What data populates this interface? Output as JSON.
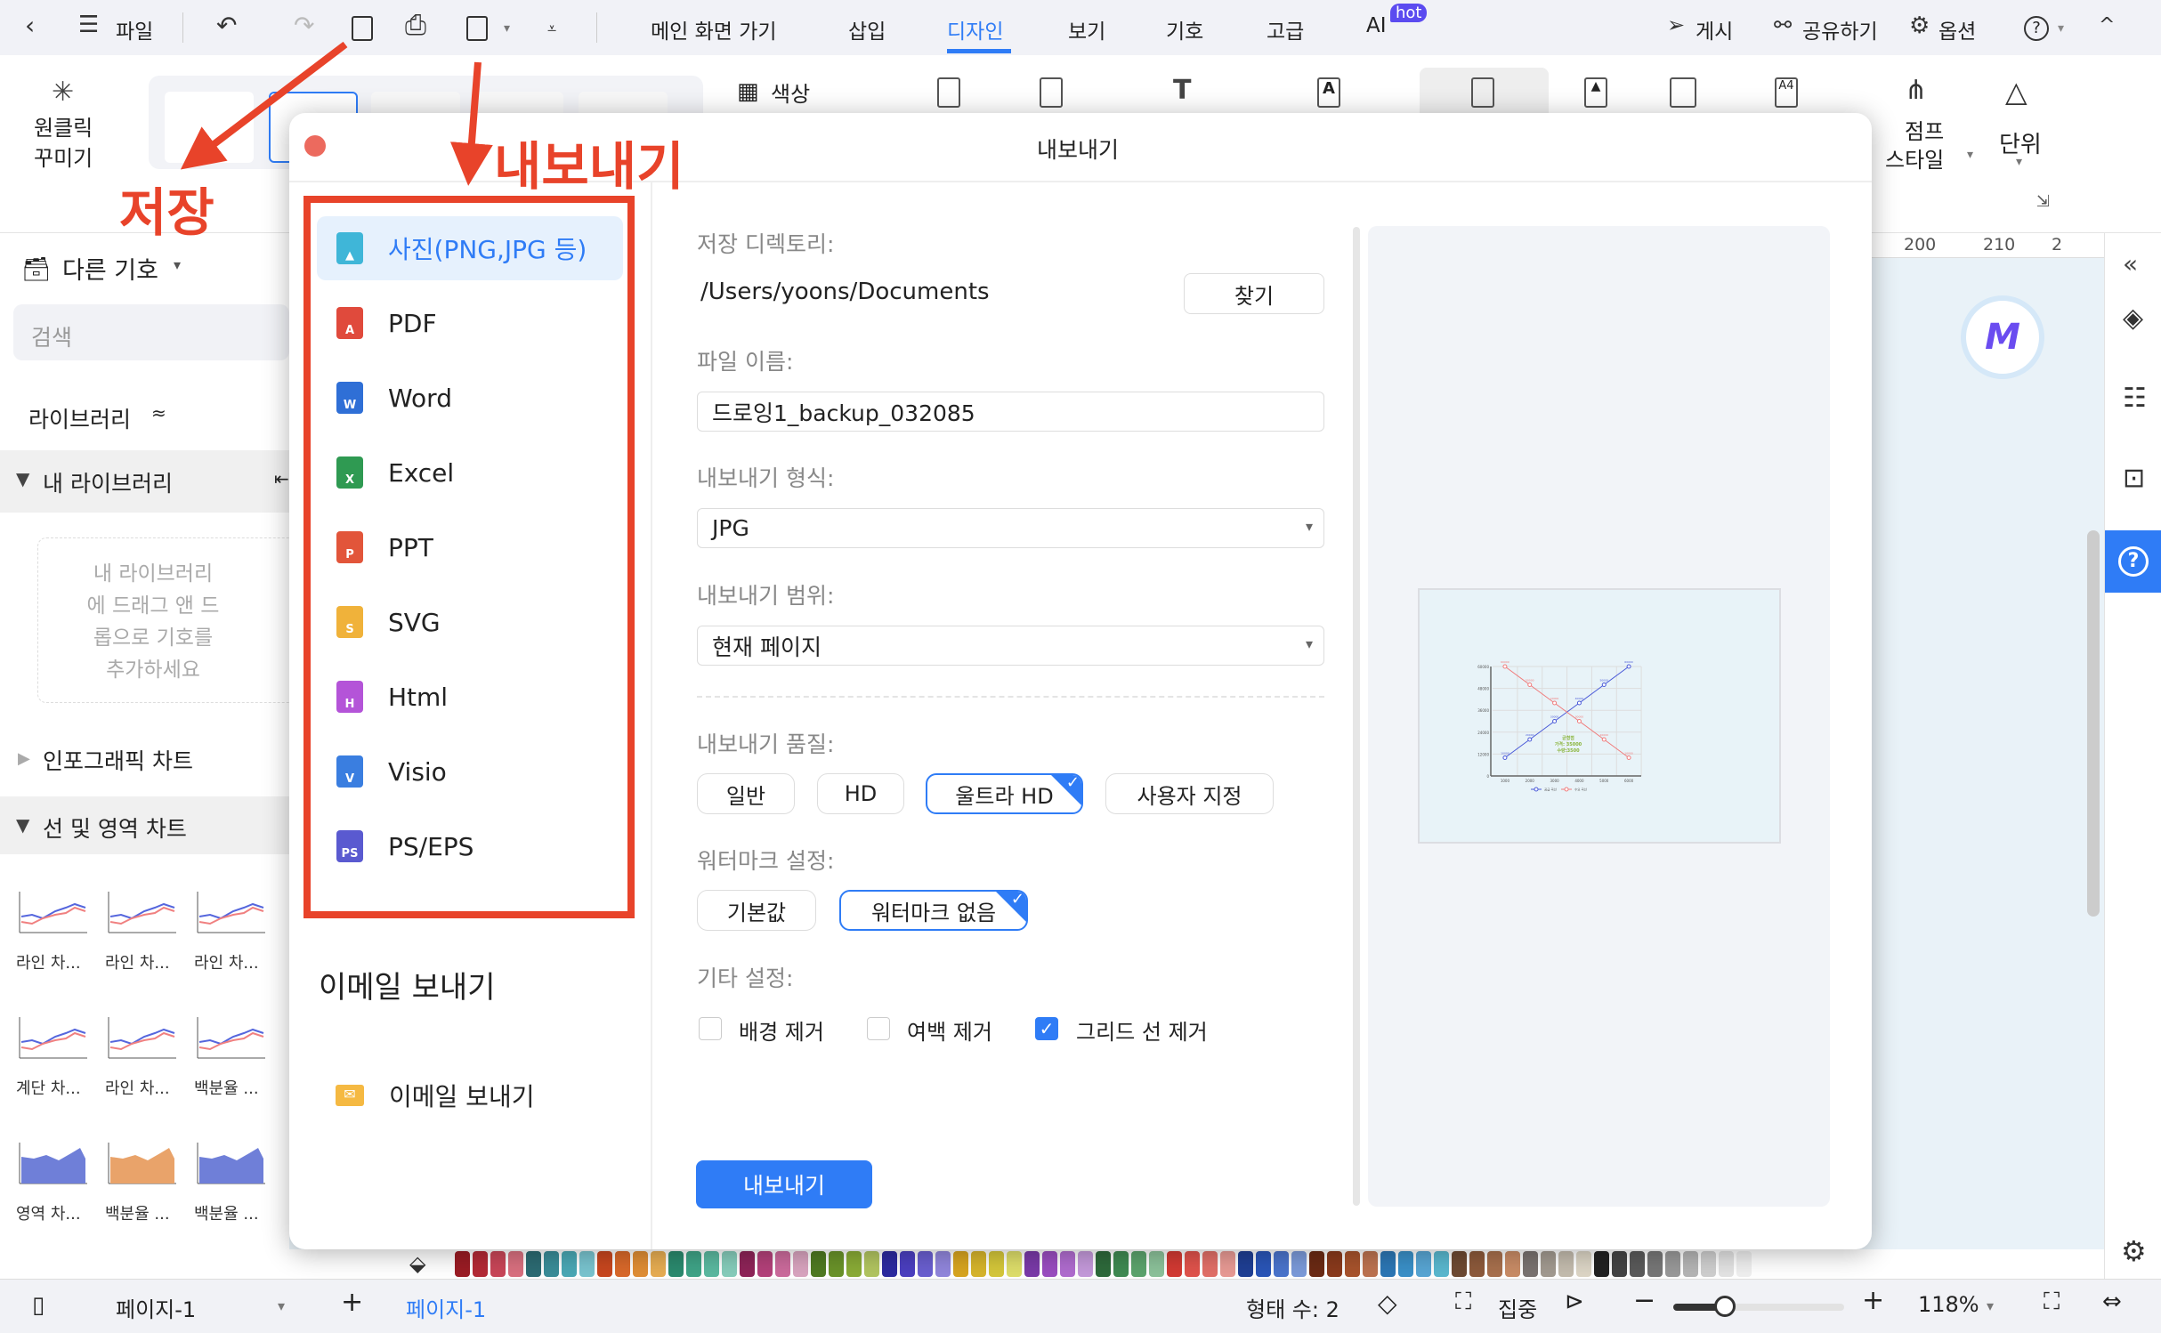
{
  "menubar": {
    "file_label": "파일",
    "tabs": [
      {
        "label": "메인 화면 가기"
      },
      {
        "label": "삽입"
      },
      {
        "label": "디자인",
        "active": true
      },
      {
        "label": "보기"
      },
      {
        "label": "기호"
      },
      {
        "label": "고급"
      },
      {
        "label": "AI",
        "badge": "hot"
      }
    ],
    "publish_label": "게시",
    "share_label": "공유하기",
    "options_label": "옵션",
    "accent_color": "#2f7cf6"
  },
  "ribbon": {
    "one_click_label_1": "원클릭",
    "one_click_label_2": "꾸미기",
    "color_label": "색상",
    "jump_style_label_1": "점프",
    "jump_style_label_2": "스타일",
    "unit_label": "단위"
  },
  "annotations": {
    "save_text": "저장",
    "export_text": "내보내기",
    "color": "#e8432a"
  },
  "sidebar": {
    "title": "다른 기호",
    "search_placeholder": "검색",
    "library_label": "라이브러리",
    "my_library_label": "내 라이브러리",
    "drop_hint": [
      "내 라이브러리",
      "에 드래그 앤 드",
      "롭으로 기호를",
      "추가하세요"
    ],
    "infographic_label": "인포그래픽 차트",
    "line_area_label": "선 및 영역 차트",
    "thumbnails": [
      {
        "label": "라인 차..."
      },
      {
        "label": "라인 차..."
      },
      {
        "label": "라인 차..."
      },
      {
        "label": "계단 차..."
      },
      {
        "label": "라인 차..."
      },
      {
        "label": "백분율 ..."
      },
      {
        "label": "영역 차..."
      },
      {
        "label": "백분율 ..."
      },
      {
        "label": "백분율 ..."
      }
    ]
  },
  "dialog": {
    "title": "내보내기",
    "formats": [
      {
        "label": "사진(PNG,JPG 등)",
        "color": "#3fb6d8",
        "glyph": "▲",
        "selected": true
      },
      {
        "label": "PDF",
        "color": "#e04a3c",
        "glyph": "A"
      },
      {
        "label": "Word",
        "color": "#2f6fd6",
        "glyph": "W"
      },
      {
        "label": "Excel",
        "color": "#2f9a52",
        "glyph": "X"
      },
      {
        "label": "PPT",
        "color": "#e2553a",
        "glyph": "P"
      },
      {
        "label": "SVG",
        "color": "#f0b23a",
        "glyph": "S"
      },
      {
        "label": "Html",
        "color": "#b454d8",
        "glyph": "H"
      },
      {
        "label": "Visio",
        "color": "#3a7ee0",
        "glyph": "V"
      },
      {
        "label": "PS/EPS",
        "color": "#5a5ad0",
        "glyph": "PS"
      }
    ],
    "email_heading": "이메일 보내기",
    "email_item": "이메일 보내기",
    "dir_label": "저장 디렉토리:",
    "dir_value": "/Users/yoons/Documents",
    "browse_label": "찾기",
    "filename_label": "파일 이름:",
    "filename_value": "드로잉1_backup_032085",
    "format_label": "내보내기 형식:",
    "format_value": "JPG",
    "range_label": "내보내기 범위:",
    "range_value": "현재 페이지",
    "quality_label": "내보내기 품질:",
    "quality_options": [
      {
        "label": "일반"
      },
      {
        "label": "HD"
      },
      {
        "label": "울트라 HD",
        "selected": true
      },
      {
        "label": "사용자 지정"
      }
    ],
    "watermark_label": "워터마크 설정:",
    "watermark_options": [
      {
        "label": "기본값"
      },
      {
        "label": "워터마크 없음",
        "selected": true
      }
    ],
    "other_label": "기타 설정:",
    "other_options": [
      {
        "label": "배경 제거",
        "checked": false
      },
      {
        "label": "여백 제거",
        "checked": false
      },
      {
        "label": "그리드 선 제거",
        "checked": true
      }
    ],
    "export_button": "내보내기",
    "preview": {
      "chart": {
        "type": "line",
        "x": [
          1000,
          2000,
          3000,
          4000,
          5000,
          6000
        ],
        "ylim": [
          0,
          60000
        ],
        "yticks": [
          "0",
          "12000",
          "24000",
          "36000",
          "48000",
          "60000"
        ],
        "xticks": [
          "1000",
          "2000",
          "3000",
          "4000",
          "5000",
          "6000"
        ],
        "series": [
          {
            "name": "공급 곡선",
            "color": "#4a5ad8",
            "values": [
              10000,
              20000,
              30000,
              40000,
              50000,
              60000
            ]
          },
          {
            "name": "수요 곡선",
            "color": "#f07c7c",
            "values": [
              60000,
              50000,
              40000,
              30000,
              20000,
              10000
            ]
          }
        ],
        "annotation": [
          "균형점",
          "가격: 35000",
          "수량:3500"
        ],
        "annotation_color": "#8ab43a"
      }
    }
  },
  "ruler": [
    "200",
    "210",
    "2"
  ],
  "palette": [
    "#9b1c24",
    "#b42a35",
    "#c94658",
    "#d9707f",
    "#2c6b73",
    "#3a8d98",
    "#4aa8b5",
    "#79c4cf",
    "#c8471f",
    "#d9692a",
    "#e08e35",
    "#e7ad52",
    "#2b8a6e",
    "#3fa487",
    "#5bb9a0",
    "#86cdbb",
    "#8e2458",
    "#b4417a",
    "#cc6b9c",
    "#d9a4bf",
    "#4f7a22",
    "#6a9329",
    "#8aac36",
    "#b2c560",
    "#2c2aa0",
    "#4b3fc0",
    "#6a5fd0",
    "#9186dc",
    "#d8a51f",
    "#d7b52b",
    "#d5c73a",
    "#dede6a",
    "#7a3aa8",
    "#9a4dc0",
    "#b06ccf",
    "#c499da",
    "#2e6a3b",
    "#3f8a52",
    "#5ca46d",
    "#8cc29a",
    "#d33a33",
    "#e0534c",
    "#e27068",
    "#e89a94",
    "#1f3f94",
    "#2a56b8",
    "#4a74cc",
    "#7b9ad9",
    "#6b2a14",
    "#8a3a1c",
    "#a8532c",
    "#bd7350",
    "#2c77b5",
    "#3a90c8",
    "#58a6d4",
    "#5ab8cf",
    "#6e4a32",
    "#8d5a3b",
    "#a8704d",
    "#c98c66",
    "#7a7370",
    "#a29a90",
    "#c4bcae",
    "#ddd6c6",
    "#222222",
    "#444444",
    "#5a5a5a",
    "#777777",
    "#999999",
    "#b5b5b5",
    "#cfcfcf",
    "#e3e3e3",
    "#efefef"
  ],
  "statusbar": {
    "page_select": "페이지-1",
    "page_tab": "페이지-1",
    "shape_count": "형태 수: 2",
    "focus_label": "집중",
    "zoom": "118%",
    "zoom_level_percent": 118
  }
}
